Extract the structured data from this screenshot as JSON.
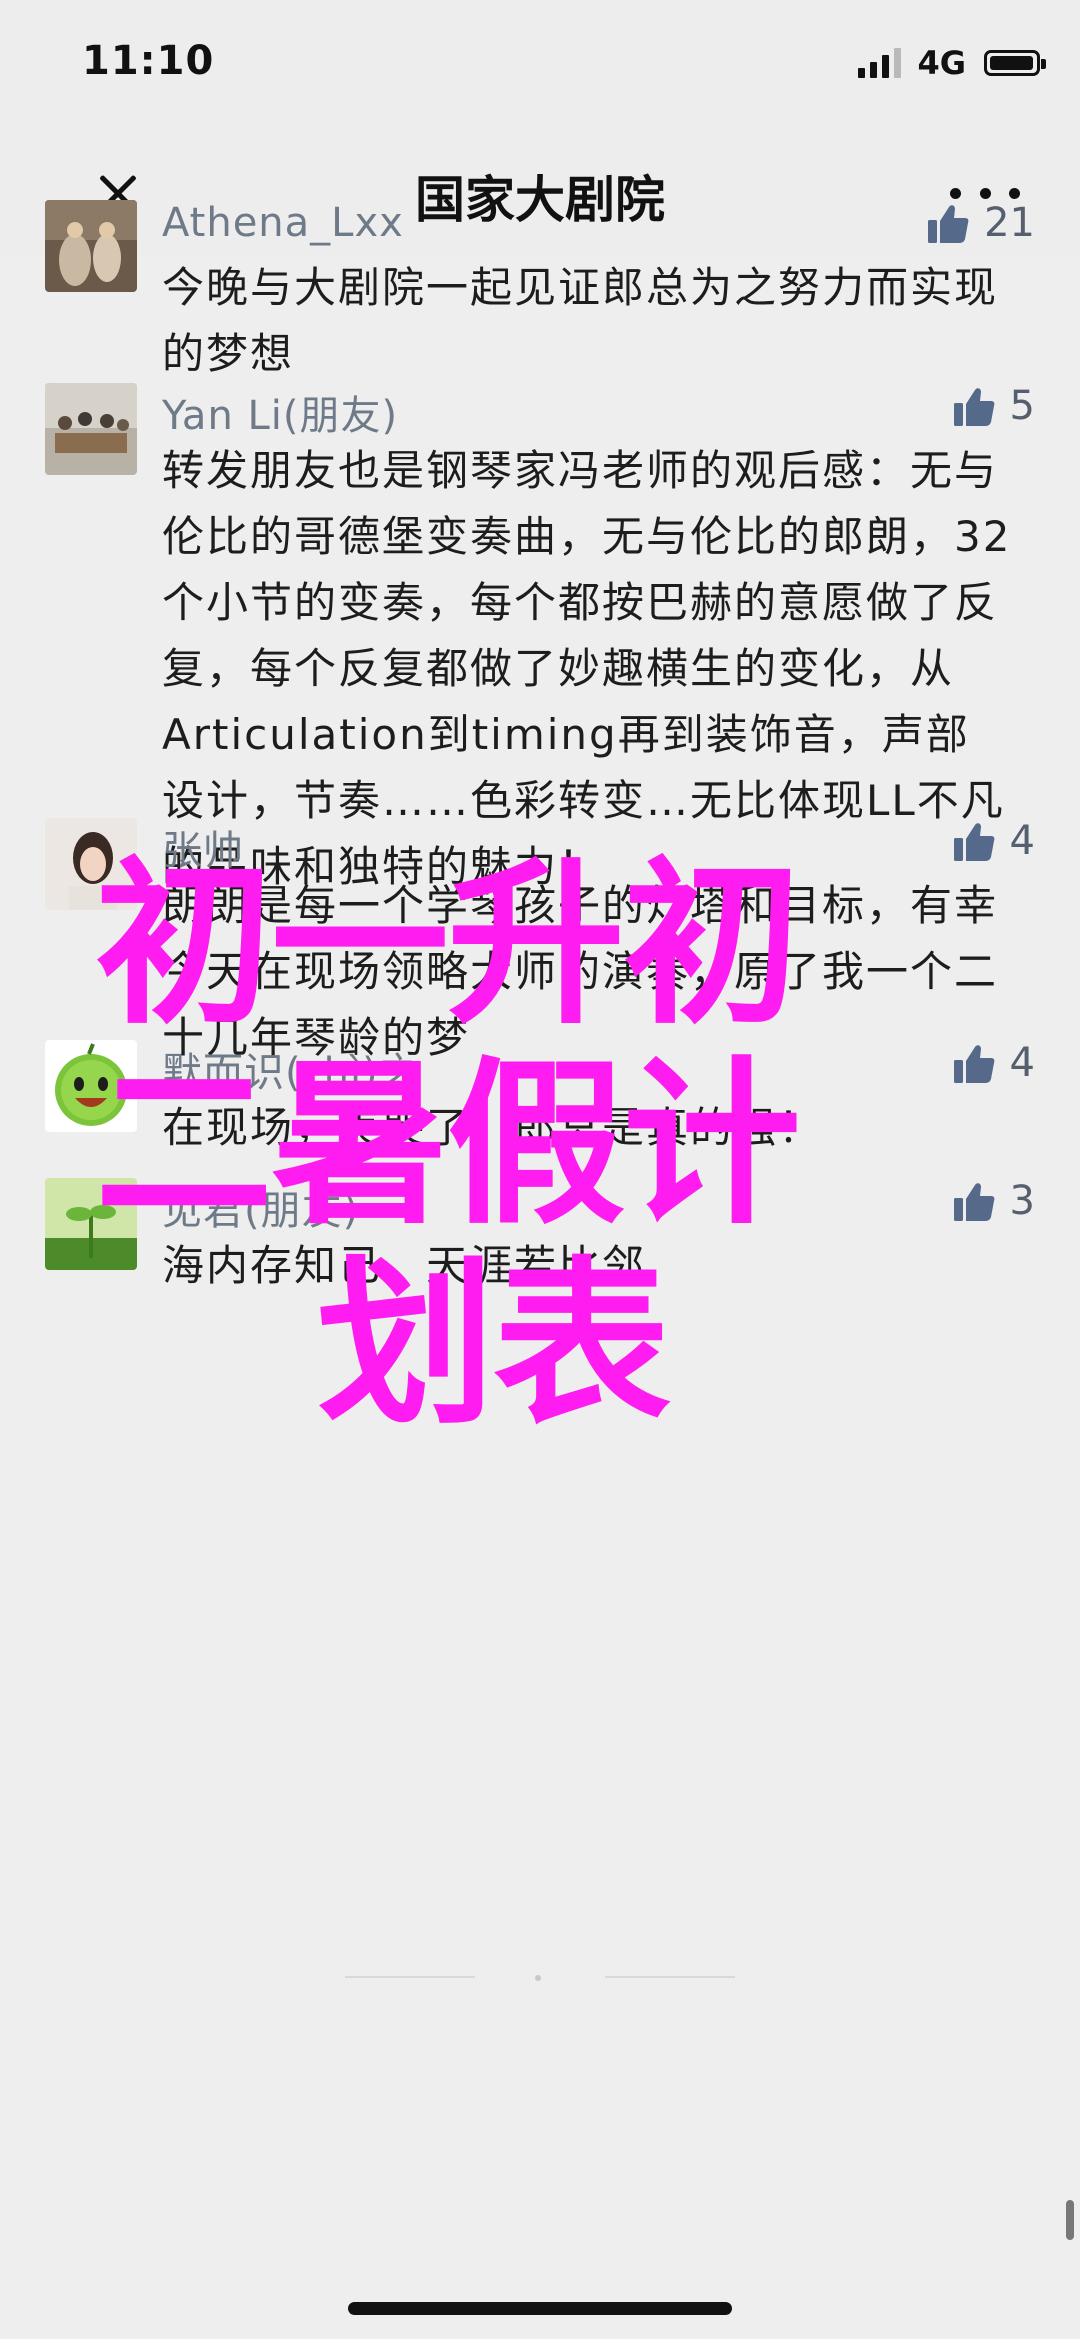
{
  "status_bar": {
    "time": "11:10",
    "network": "4G"
  },
  "nav": {
    "title": "国家大剧院"
  },
  "comments": [
    {
      "name": "Athena_Lxx",
      "likes": "21",
      "text": "今晚与大剧院一起见证郎总为之努力而实现的梦想"
    },
    {
      "name": "Yan Li(朋友)",
      "likes": "5",
      "text": "转发朋友也是钢琴家冯老师的观后感：无与伦比的哥德堡变奏曲，无与伦比的郎朗，32个小节的变奏，每个都按巴赫的意愿做了反复，每个反复都做了妙趣横生的变化，从Articulation到timing再到装饰音，声部设计，节奏……色彩转变…无比体现LL不凡的品味和独特的魅力！"
    },
    {
      "name": "张帅",
      "likes": "4",
      "text": "朗朗是每一个学琴孩子的灯塔和目标，有幸今天在现场领略大师的演奏，原了我一个二十几年琴龄的梦"
    },
    {
      "name": "默而识(zhì)之",
      "likes": "4",
      "text": "在现场，美哭了，郎总是真的强！"
    },
    {
      "name": "见君(朋友)",
      "likes": "3",
      "text": "海内存知己，天涯若比邻"
    }
  ],
  "overlay": {
    "line1": "初一升初",
    "line2": "二暑假计",
    "line3": "划表"
  },
  "colors": {
    "overlay": "#ff1cf0",
    "name": "#6f7a88",
    "background": "#eeeeee"
  },
  "icons": {
    "like": "thumbs-up-icon",
    "close": "close-icon",
    "more": "more-icon"
  }
}
